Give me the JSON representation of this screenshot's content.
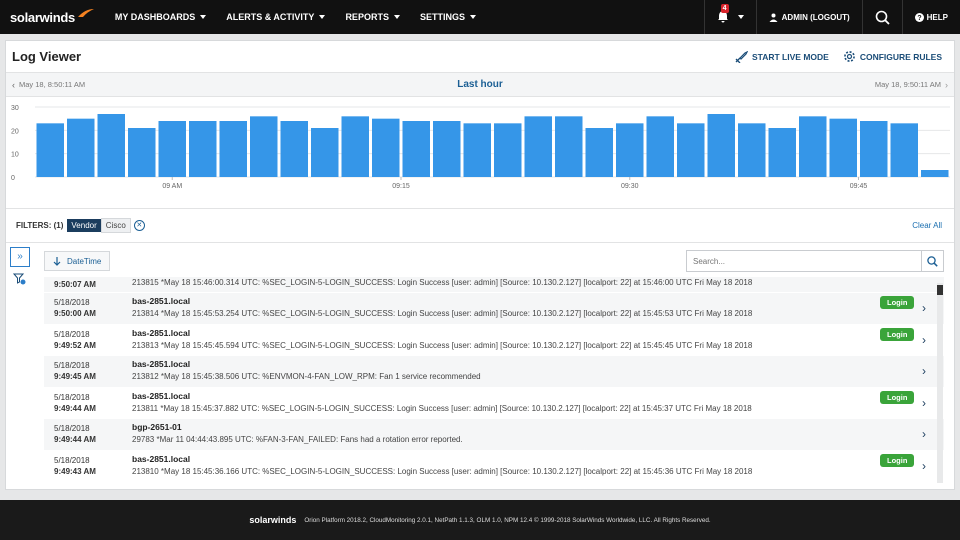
{
  "nav": {
    "logo": "solarwinds",
    "items": [
      "MY DASHBOARDS",
      "ALERTS & ACTIVITY",
      "REPORTS",
      "SETTINGS"
    ],
    "alerts_count": "4",
    "user": "ADMIN (LOGOUT)",
    "help": "HELP"
  },
  "page": {
    "title": "Log Viewer",
    "start_live": "START LIVE MODE",
    "configure": "CONFIGURE RULES"
  },
  "range": {
    "start": "May 18, 8:50:11 AM",
    "label": "Last hour",
    "end": "May 18, 9:50:11 AM"
  },
  "chart_data": {
    "type": "bar",
    "values": [
      23,
      25,
      27,
      21,
      24,
      24,
      24,
      26,
      24,
      21,
      26,
      25,
      24,
      24,
      23,
      23,
      26,
      26,
      21,
      23,
      26,
      23,
      27,
      23,
      21,
      26,
      25,
      24,
      23,
      3
    ],
    "ylim": [
      0,
      30
    ],
    "yticks": [
      "30",
      "20",
      "10",
      "0"
    ],
    "xticks": [
      {
        "label": "09 AM",
        "index": 4
      },
      {
        "label": "09:15",
        "index": 11.5
      },
      {
        "label": "09:30",
        "index": 19
      },
      {
        "label": "09:45",
        "index": 26.5
      }
    ],
    "bar_color": "#3596e8",
    "grid": true
  },
  "filters": {
    "label": "FILTERS: (1)",
    "key": "Vendor",
    "value": "Cisco",
    "clear": "Clear All"
  },
  "toolbar": {
    "sort_label": "DateTime",
    "search_placeholder": "Search..."
  },
  "first_row": {
    "time": "9:50:07 AM",
    "msg": "213815 *May 18 15:46:00.314 UTC: %SEC_LOGIN-5-LOGIN_SUCCESS: Login Success [user: admin] [Source: 10.130.2.127] [localport: 22] at 15:46:00 UTC Fri May 18 2018"
  },
  "rows": [
    {
      "date": "5/18/2018",
      "time": "9:50:00 AM",
      "host": "bas-2851.local",
      "msg": "213814 *May 18 15:45:53.254 UTC: %SEC_LOGIN-5-LOGIN_SUCCESS: Login Success [user: admin] [Source: 10.130.2.127] [localport: 22] at 15:45:53 UTC Fri May 18 2018",
      "badge": "Login"
    },
    {
      "date": "5/18/2018",
      "time": "9:49:52 AM",
      "host": "bas-2851.local",
      "msg": "213813 *May 18 15:45:45.594 UTC: %SEC_LOGIN-5-LOGIN_SUCCESS: Login Success [user: admin] [Source: 10.130.2.127] [localport: 22] at 15:45:45 UTC Fri May 18 2018",
      "badge": "Login"
    },
    {
      "date": "5/18/2018",
      "time": "9:49:45 AM",
      "host": "bas-2851.local",
      "msg": "213812 *May 18 15:45:38.506 UTC: %ENVMON-4-FAN_LOW_RPM: Fan 1 service recommended",
      "badge": ""
    },
    {
      "date": "5/18/2018",
      "time": "9:49:44 AM",
      "host": "bas-2851.local",
      "msg": "213811 *May 18 15:45:37.882 UTC: %SEC_LOGIN-5-LOGIN_SUCCESS: Login Success [user: admin] [Source: 10.130.2.127] [localport: 22] at 15:45:37 UTC Fri May 18 2018",
      "badge": "Login"
    },
    {
      "date": "5/18/2018",
      "time": "9:49:44 AM",
      "host": "bgp-2651-01",
      "msg": "29783 *Mar 11 04:44:43.895 UTC: %FAN-3-FAN_FAILED: Fans had a rotation error reported.",
      "badge": ""
    },
    {
      "date": "5/18/2018",
      "time": "9:49:43 AM",
      "host": "bas-2851.local",
      "msg": "213810 *May 18 15:45:36.166 UTC: %SEC_LOGIN-5-LOGIN_SUCCESS: Login Success [user: admin] [Source: 10.130.2.127] [localport: 22] at 15:45:36 UTC Fri May 18 2018",
      "badge": "Login"
    }
  ],
  "footer": {
    "logo": "solarwinds",
    "text": "Orion Platform 2018.2, CloudMonitoring 2.0.1, NetPath 1.1.3, OLM 1.0, NPM 12.4 © 1999-2018 SolarWinds Worldwide, LLC. All Rights Reserved."
  }
}
